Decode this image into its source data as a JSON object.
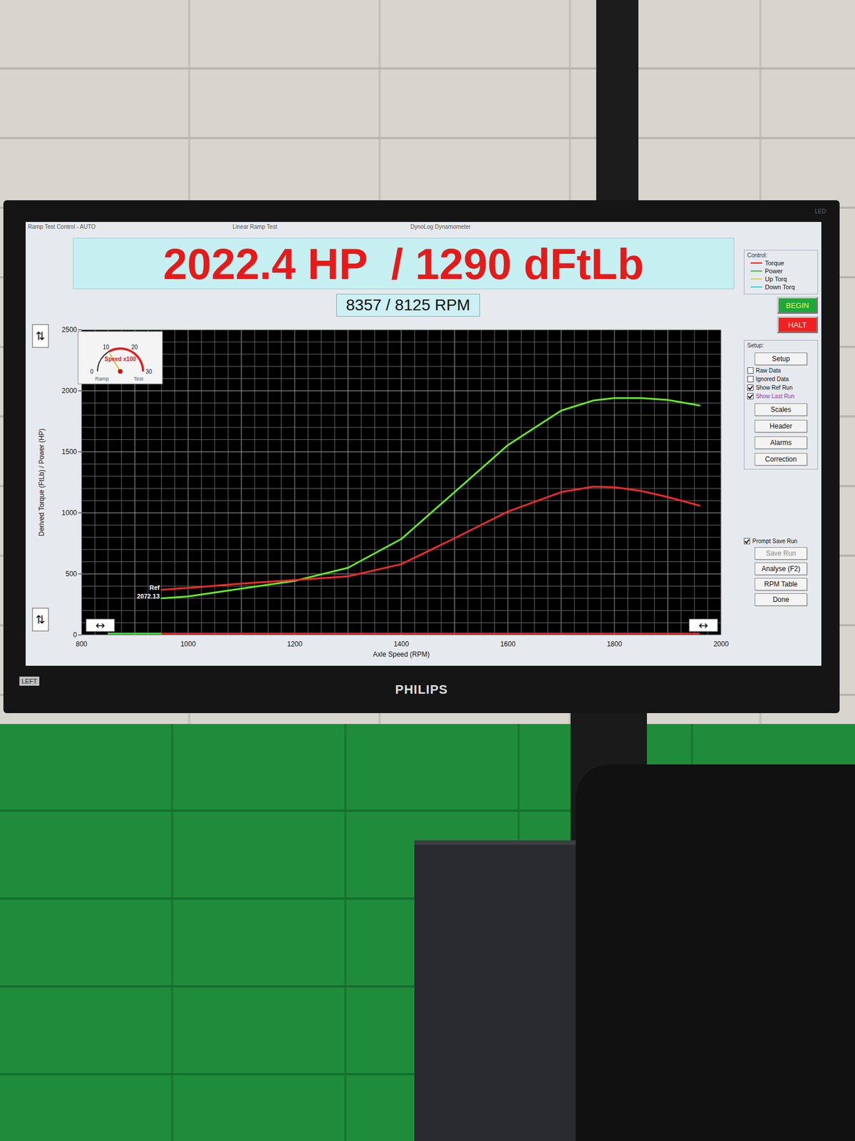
{
  "window": {
    "title": "Ramp Test Control - AUTO",
    "subtitle": "Linear Ramp Test",
    "app": "DynoLog Dynamometer"
  },
  "readout": {
    "main": "2022.4 HP  / 1290 dFtLb",
    "rpm": "8357 / 8125 RPM"
  },
  "chart": {
    "y_axis_title": "Derived Torque (FtLb) / Power (HP)",
    "x_axis_title": "Axle Speed (RPM)",
    "y_ticks": [
      "0",
      "500",
      "1000",
      "1500",
      "2000",
      "2500"
    ],
    "x_ticks": [
      "800",
      "1000",
      "1200",
      "1400",
      "1600",
      "1800",
      "2000"
    ],
    "x_values": [
      950,
      1000,
      1100,
      1200,
      1300,
      1400,
      1500,
      1600,
      1700,
      1760,
      1800,
      1850,
      1900,
      1960
    ],
    "series": [
      {
        "name": "Power",
        "color": "#66ee22",
        "values": [
          300,
          315,
          380,
          443,
          550,
          786,
          1170,
          1555,
          1838,
          1920,
          1940,
          1940,
          1925,
          1880
        ]
      },
      {
        "name": "Torque",
        "color": "#ff2a2a",
        "values": [
          370,
          385,
          420,
          450,
          480,
          580,
          792,
          1011,
          1170,
          1215,
          1210,
          1180,
          1130,
          1060
        ]
      }
    ],
    "ref_labels": [
      "Ref",
      "2072.13"
    ],
    "scroll_buttons": [
      "⇅",
      "⇅",
      "↔",
      "↔"
    ],
    "ramp": {
      "level": 0.09
    },
    "gauge": {
      "title": "Speed x100",
      "ticks": [
        "0",
        "10",
        "20",
        "30"
      ],
      "level": 0.33,
      "modes": [
        "Ramp",
        "Test"
      ]
    }
  },
  "control": {
    "title": "Control:",
    "legend": [
      {
        "label": "Torque",
        "color": "#e52020"
      },
      {
        "label": "Power",
        "color": "#33cc33"
      },
      {
        "label": "Up Torq",
        "color": "#d8d820"
      },
      {
        "label": "Down Torq",
        "color": "#40c8e0"
      }
    ],
    "buttons": [
      {
        "label": "BEGIN",
        "color": "#1fa83a"
      },
      {
        "label": "HALT",
        "color": "#ee2222"
      }
    ]
  },
  "setup": {
    "title": "Setup:",
    "button": "Setup",
    "options": [
      {
        "label": "Raw Data",
        "checked": false,
        "color": "#111111"
      },
      {
        "label": "Ignored Data",
        "checked": false,
        "color": "#111111"
      },
      {
        "label": "Show Ref Run",
        "checked": true,
        "color": "#111111"
      },
      {
        "label": "Show Last Run",
        "checked": true,
        "color": "#9a2fb0"
      }
    ],
    "buttons": [
      "Scales",
      "Header",
      "Alarms",
      "Correction"
    ]
  },
  "run": {
    "prompt": {
      "label": "Prompt Save Run",
      "checked": true
    },
    "buttons": [
      {
        "label": "Save Run",
        "disabled": true
      },
      {
        "label": "Analyse (F2)",
        "disabled": false
      },
      {
        "label": "RPM Table",
        "disabled": false
      },
      {
        "label": "Done",
        "disabled": false
      }
    ]
  },
  "monitor": {
    "badge": "LED",
    "tag": "LEFT",
    "brand": "PHILIPS"
  }
}
